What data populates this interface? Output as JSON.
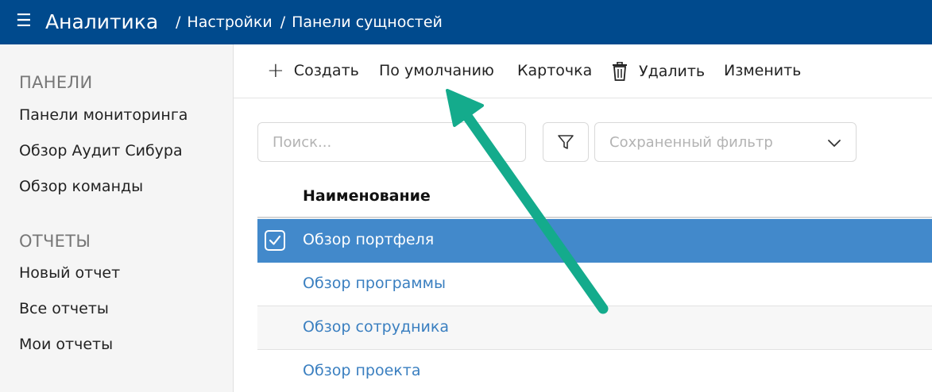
{
  "header": {
    "app_title": "Аналитика",
    "breadcrumb": [
      "Настройки",
      "Панели сущностей"
    ],
    "bg_color": "#004a8d"
  },
  "sidebar": {
    "sections": [
      {
        "title": "ПАНЕЛИ",
        "items": [
          "Панели мониторинга",
          "Обзор Аудит Сибура",
          "Обзор команды"
        ]
      },
      {
        "title": "ОТЧЕТЫ",
        "items": [
          "Новый отчет",
          "Все отчеты",
          "Мои отчеты"
        ]
      }
    ]
  },
  "toolbar": {
    "create_label": "Создать",
    "default_label": "По умолчанию",
    "card_label": "Карточка",
    "delete_label": "Удалить",
    "edit_label": "Изменить"
  },
  "filters": {
    "search_placeholder": "Поиск...",
    "saved_filter_placeholder": "Сохраненный фильтр"
  },
  "table": {
    "column_header": "Наименование",
    "rows": [
      {
        "name": "Обзор портфеля",
        "selected": true
      },
      {
        "name": "Обзор программы",
        "selected": false
      },
      {
        "name": "Обзор сотрудника",
        "selected": false
      },
      {
        "name": "Обзор проекта",
        "selected": false
      }
    ],
    "selected_color": "#4289cb",
    "link_color": "#3a7fc0"
  },
  "annotation": {
    "arrow_color": "#14ab8c",
    "points_to": "default-button"
  }
}
